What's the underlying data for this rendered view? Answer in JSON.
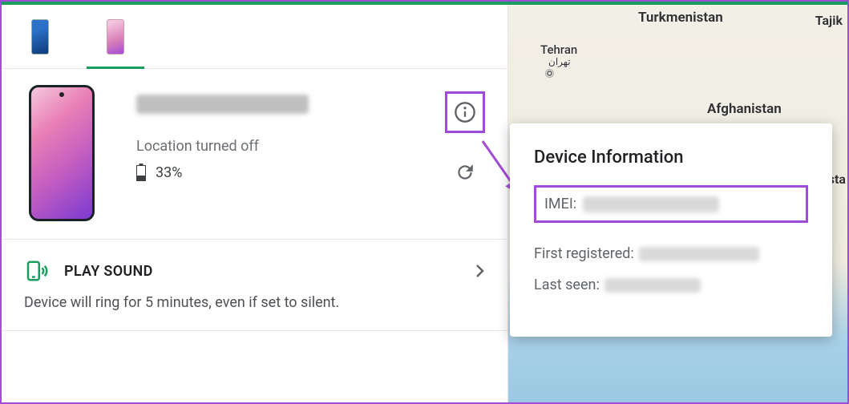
{
  "device": {
    "location_status": "Location turned off",
    "battery_pct": "33%"
  },
  "actions": {
    "play_sound_label": "PLAY SOUND",
    "play_sound_desc": "Device will ring for 5 minutes, even if set to silent."
  },
  "popover": {
    "title": "Device Information",
    "imei_label": "IMEI:",
    "first_registered_label": "First registered:",
    "last_seen_label": "Last seen:"
  },
  "map": {
    "labels": {
      "turkmenistan": "Turkmenistan",
      "tehran": "Tehran",
      "tehran_native": "تهران",
      "afghanistan": "Afghanistan",
      "tajik": "Tajik",
      "ista": "ista"
    }
  },
  "colors": {
    "accent_green": "#1a9e60",
    "highlight_purple": "#a24bd6"
  }
}
